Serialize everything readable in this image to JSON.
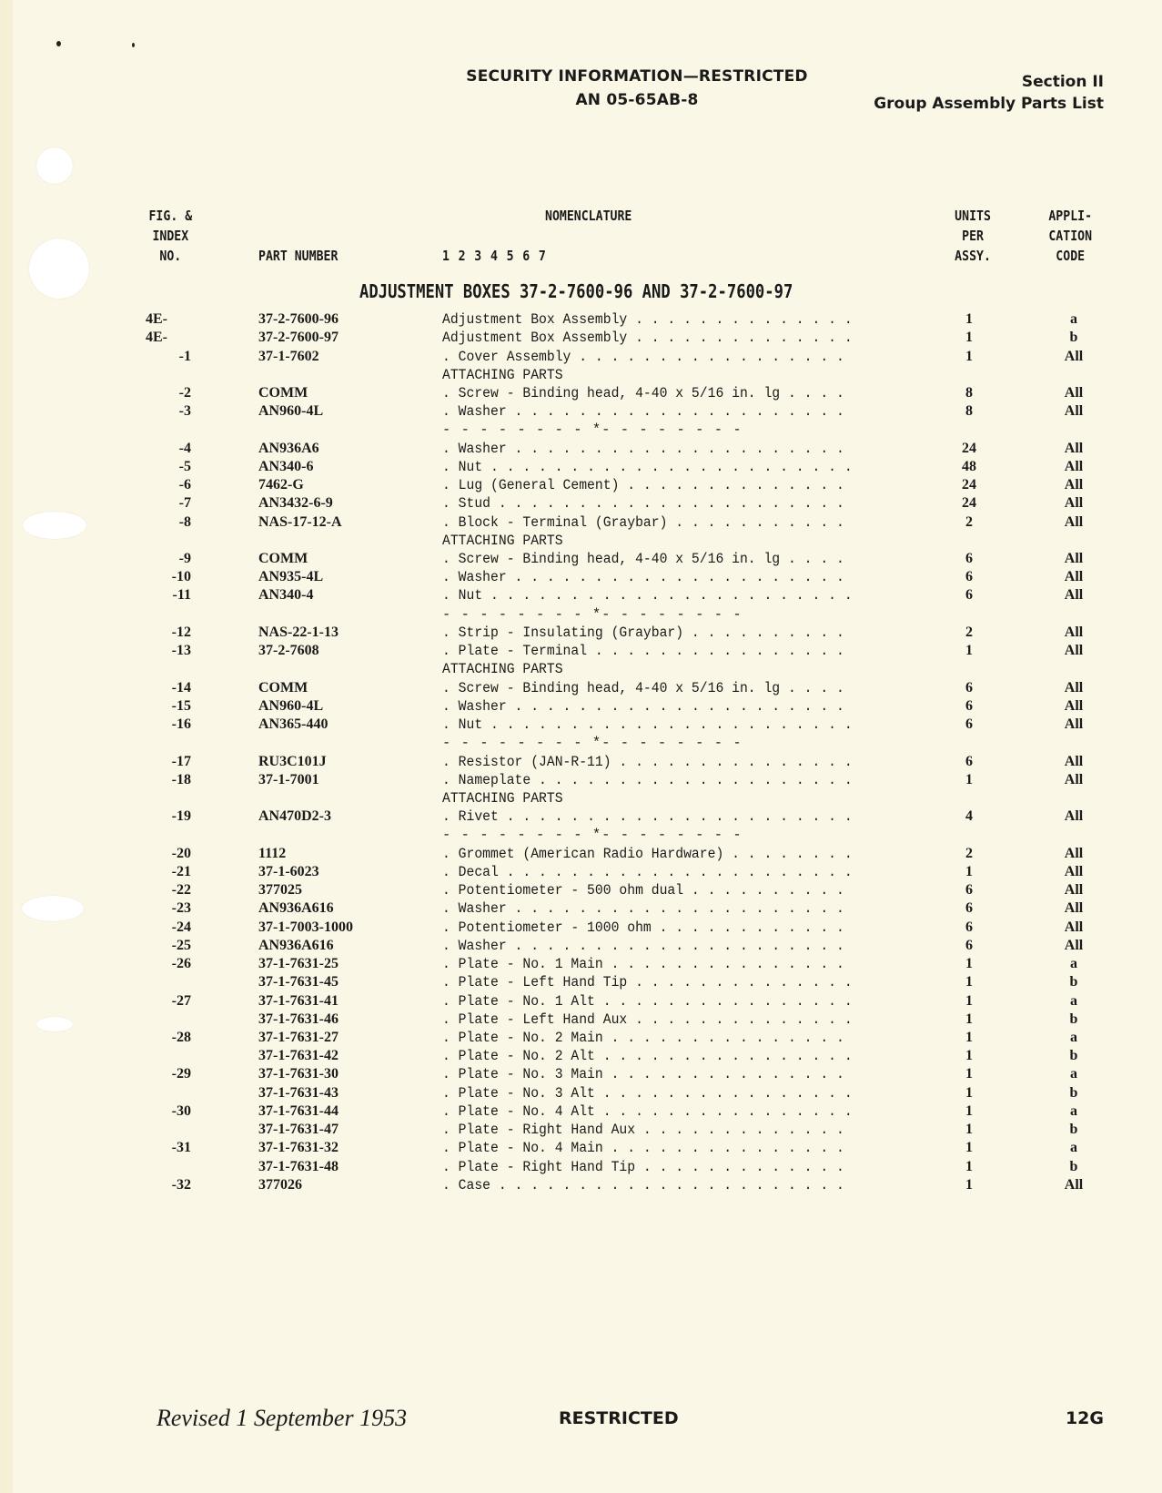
{
  "header": {
    "security": "SECURITY INFORMATION—RESTRICTED",
    "doc_number": "AN 05-65AB-8",
    "section": "Section II",
    "section_title": "Group Assembly Parts List"
  },
  "columns": {
    "fig_index": [
      "FIG. &",
      "INDEX",
      "NO."
    ],
    "part_number": "PART NUMBER",
    "nomenclature": "NOMENCLATURE",
    "indent_levels": "1 2 3 4 5 6 7",
    "units": [
      "UNITS",
      "PER",
      "ASSY."
    ],
    "application": [
      "APPLI-",
      "CATION",
      "CODE"
    ]
  },
  "section_title": "ADJUSTMENT BOXES 37-2-7600-96 AND 37-2-7600-97",
  "rows": [
    {
      "type": "item",
      "fig": "4E-",
      "part": "37-2-7600-96",
      "desc": "Adjustment Box Assembly",
      "qty": "1",
      "code": "a"
    },
    {
      "type": "item",
      "fig": "4E-",
      "part": "37-2-7600-97",
      "desc": "Adjustment Box Assembly",
      "qty": "1",
      "code": "b"
    },
    {
      "type": "item",
      "idx": "-1",
      "part": "37-1-7602",
      "desc": ". Cover Assembly",
      "qty": "1",
      "code": "All"
    },
    {
      "type": "label",
      "desc": "ATTACHING PARTS"
    },
    {
      "type": "item",
      "idx": "-2",
      "part": "COMM",
      "desc": ". Screw - Binding head, 4-40 x 5/16 in. lg",
      "qty": "8",
      "code": "All"
    },
    {
      "type": "item",
      "idx": "-3",
      "part": "AN960-4L",
      "desc": ". Washer",
      "qty": "8",
      "code": "All"
    },
    {
      "type": "separator",
      "desc": "- - - - - - - - *- - - - - - - -"
    },
    {
      "type": "item",
      "idx": "-4",
      "part": "AN936A6",
      "desc": ". Washer",
      "qty": "24",
      "code": "All"
    },
    {
      "type": "item",
      "idx": "-5",
      "part": "AN340-6",
      "desc": ". Nut",
      "qty": "48",
      "code": "All"
    },
    {
      "type": "item",
      "idx": "-6",
      "part": "7462-G",
      "desc": ". Lug (General Cement)",
      "qty": "24",
      "code": "All"
    },
    {
      "type": "item",
      "idx": "-7",
      "part": "AN3432-6-9",
      "desc": ". Stud",
      "qty": "24",
      "code": "All"
    },
    {
      "type": "item",
      "idx": "-8",
      "part": "NAS-17-12-A",
      "desc": ". Block - Terminal (Graybar)",
      "qty": "2",
      "code": "All"
    },
    {
      "type": "label",
      "desc": "ATTACHING PARTS"
    },
    {
      "type": "item",
      "idx": "-9",
      "part": "COMM",
      "desc": ". Screw - Binding head, 4-40 x 5/16 in. lg",
      "qty": "6",
      "code": "All"
    },
    {
      "type": "item",
      "idx": "-10",
      "part": "AN935-4L",
      "desc": ". Washer",
      "qty": "6",
      "code": "All"
    },
    {
      "type": "item",
      "idx": "-11",
      "part": "AN340-4",
      "desc": ". Nut",
      "qty": "6",
      "code": "All"
    },
    {
      "type": "separator",
      "desc": "- - - - - - - - *- - - - - - - -"
    },
    {
      "type": "item",
      "idx": "-12",
      "part": "NAS-22-1-13",
      "desc": ". Strip - Insulating (Graybar)",
      "qty": "2",
      "code": "All"
    },
    {
      "type": "item",
      "idx": "-13",
      "part": "37-2-7608",
      "desc": ". Plate - Terminal",
      "qty": "1",
      "code": "All"
    },
    {
      "type": "label",
      "desc": "ATTACHING PARTS"
    },
    {
      "type": "item",
      "idx": "-14",
      "part": "COMM",
      "desc": ". Screw - Binding head, 4-40 x 5/16 in. lg",
      "qty": "6",
      "code": "All"
    },
    {
      "type": "item",
      "idx": "-15",
      "part": "AN960-4L",
      "desc": ". Washer",
      "qty": "6",
      "code": "All"
    },
    {
      "type": "item",
      "idx": "-16",
      "part": "AN365-440",
      "desc": ". Nut",
      "qty": "6",
      "code": "All"
    },
    {
      "type": "separator",
      "desc": "- - - - - - - - *- - - - - - - -"
    },
    {
      "type": "item",
      "idx": "-17",
      "part": "RU3C101J",
      "desc": ". Resistor (JAN-R-11)",
      "qty": "6",
      "code": "All"
    },
    {
      "type": "item",
      "idx": "-18",
      "part": "37-1-7001",
      "desc": ". Nameplate",
      "qty": "1",
      "code": "All"
    },
    {
      "type": "label",
      "desc": "ATTACHING PARTS"
    },
    {
      "type": "item",
      "idx": "-19",
      "part": "AN470D2-3",
      "desc": ". Rivet",
      "qty": "4",
      "code": "All"
    },
    {
      "type": "separator",
      "desc": "- - - - - - - - *- - - - - - - -"
    },
    {
      "type": "item",
      "idx": "-20",
      "part": "1112",
      "desc": ". Grommet (American Radio Hardware)",
      "qty": "2",
      "code": "All"
    },
    {
      "type": "item",
      "idx": "-21",
      "part": "37-1-6023",
      "desc": ". Decal",
      "qty": "1",
      "code": "All"
    },
    {
      "type": "item",
      "idx": "-22",
      "part": "377025",
      "desc": ". Potentiometer - 500 ohm dual",
      "qty": "6",
      "code": "All"
    },
    {
      "type": "item",
      "idx": "-23",
      "part": "AN936A616",
      "desc": ". Washer",
      "qty": "6",
      "code": "All"
    },
    {
      "type": "item",
      "idx": "-24",
      "part": "37-1-7003-1000",
      "desc": ". Potentiometer - 1000 ohm",
      "qty": "6",
      "code": "All"
    },
    {
      "type": "item",
      "idx": "-25",
      "part": "AN936A616",
      "desc": ". Washer",
      "qty": "6",
      "code": "All"
    },
    {
      "type": "item",
      "idx": "-26",
      "part": "37-1-7631-25",
      "desc": ". Plate - No. 1 Main",
      "qty": "1",
      "code": "a"
    },
    {
      "type": "item",
      "idx": "",
      "part": "37-1-7631-45",
      "desc": ". Plate - Left Hand Tip",
      "qty": "1",
      "code": "b"
    },
    {
      "type": "item",
      "idx": "-27",
      "part": "37-1-7631-41",
      "desc": ". Plate - No. 1 Alt",
      "qty": "1",
      "code": "a"
    },
    {
      "type": "item",
      "idx": "",
      "part": "37-1-7631-46",
      "desc": ". Plate - Left Hand Aux",
      "qty": "1",
      "code": "b"
    },
    {
      "type": "item",
      "idx": "-28",
      "part": "37-1-7631-27",
      "desc": ". Plate - No. 2 Main",
      "qty": "1",
      "code": "a"
    },
    {
      "type": "item",
      "idx": "",
      "part": "37-1-7631-42",
      "desc": ". Plate - No. 2 Alt",
      "qty": "1",
      "code": "b"
    },
    {
      "type": "item",
      "idx": "-29",
      "part": "37-1-7631-30",
      "desc": ". Plate - No. 3 Main",
      "qty": "1",
      "code": "a"
    },
    {
      "type": "item",
      "idx": "",
      "part": "37-1-7631-43",
      "desc": ". Plate - No. 3 Alt",
      "qty": "1",
      "code": "b"
    },
    {
      "type": "item",
      "idx": "-30",
      "part": "37-1-7631-44",
      "desc": ". Plate - No. 4 Alt",
      "qty": "1",
      "code": "a"
    },
    {
      "type": "item",
      "idx": "",
      "part": "37-1-7631-47",
      "desc": ". Plate - Right Hand Aux",
      "qty": "1",
      "code": "b"
    },
    {
      "type": "item",
      "idx": "-31",
      "part": "37-1-7631-32",
      "desc": ". Plate - No. 4 Main",
      "qty": "1",
      "code": "a"
    },
    {
      "type": "item",
      "idx": "",
      "part": "37-1-7631-48",
      "desc": ". Plate - Right Hand Tip",
      "qty": "1",
      "code": "b"
    },
    {
      "type": "item",
      "idx": "-32",
      "part": "377026",
      "desc": ". Case",
      "qty": "1",
      "code": "All"
    }
  ],
  "footer": {
    "revised": "Revised 1 September 1953",
    "classification": "RESTRICTED",
    "page": "12G"
  }
}
